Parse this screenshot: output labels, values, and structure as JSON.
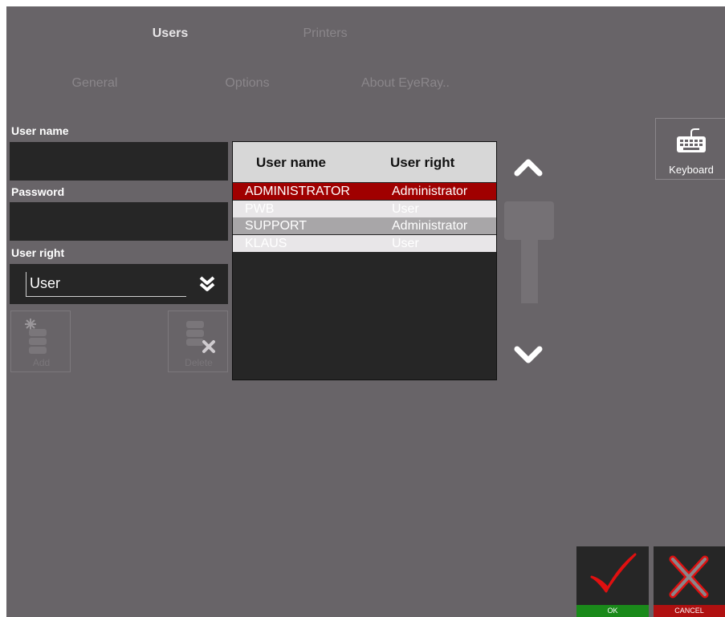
{
  "tabs_top": [
    {
      "label": "Users",
      "active": true
    },
    {
      "label": "Printers",
      "active": false
    }
  ],
  "tabs_sub": [
    {
      "label": "General"
    },
    {
      "label": "Options"
    },
    {
      "label": "About EyeRay.."
    }
  ],
  "form": {
    "username_label": "User name",
    "username_value": "",
    "password_label": "Password",
    "password_value": "",
    "user_right_label": "User right",
    "user_right_value": "User"
  },
  "toolbar": {
    "add_label": "Add",
    "delete_label": "Delete"
  },
  "table": {
    "columns": [
      "User name",
      "User right"
    ],
    "rows": [
      {
        "name": "ADMINISTRATOR",
        "right": "Administrator",
        "state": "selected"
      },
      {
        "name": "PWB",
        "right": "User",
        "state": "light"
      },
      {
        "name": "SUPPORT",
        "right": "Administrator",
        "state": "mid"
      },
      {
        "name": "KLAUS",
        "right": "User",
        "state": "light"
      }
    ]
  },
  "keyboard": {
    "label": "Keyboard",
    "icon": "keyboard-icon"
  },
  "actions": {
    "ok_label": "OK",
    "cancel_label": "CANCEL"
  },
  "colors": {
    "background": "#686468",
    "selected_row": "#a00000",
    "light_row": "#e8e6e8",
    "mid_row": "#a8a6a8",
    "ok_accent": "#1a8a1a",
    "cancel_accent": "#b01010",
    "check_red": "#e01010"
  }
}
